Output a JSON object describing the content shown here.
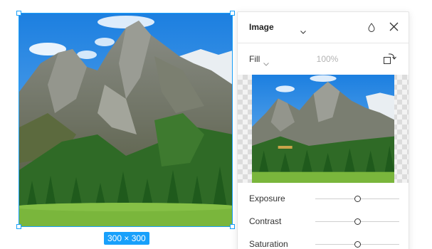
{
  "canvas": {
    "size_label": "300 × 300"
  },
  "panel": {
    "title": "Image",
    "icons": {
      "title_dropdown": "chevron-down-icon",
      "style": "drop-icon",
      "close": "close-icon",
      "rotate": "rotate-icon"
    },
    "fill": {
      "mode": "Fill",
      "opacity": "100%"
    },
    "adjustments": [
      {
        "label": "Exposure",
        "value": 0.5
      },
      {
        "label": "Contrast",
        "value": 0.5
      },
      {
        "label": "Saturation",
        "value": 0.5
      }
    ]
  },
  "colors": {
    "selection": "#18a0fb",
    "badge_text": "#ffffff"
  }
}
